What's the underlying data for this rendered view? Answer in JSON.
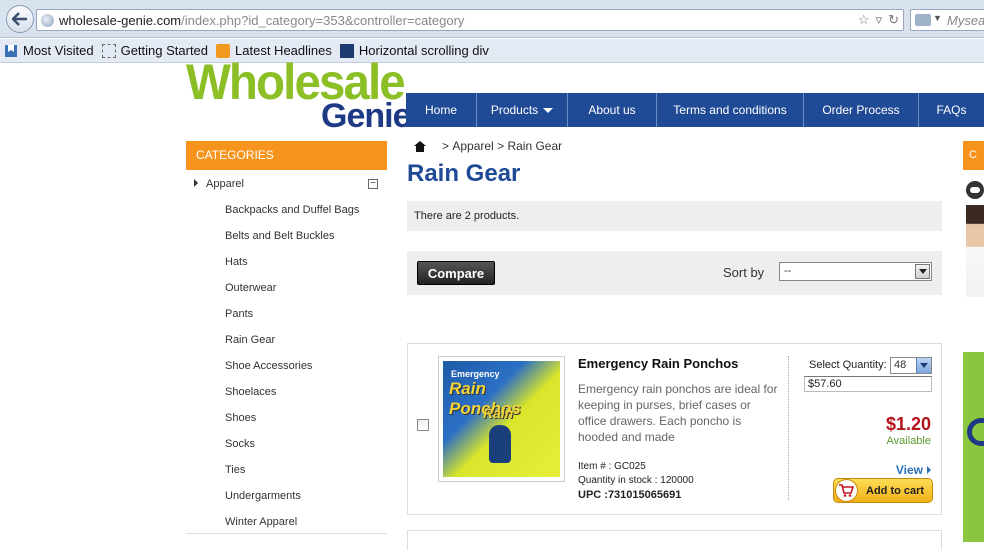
{
  "browser": {
    "url_domain": "wholesale-genie.com",
    "url_path": "/index.php?id_category=353&controller=category",
    "search_placeholder": "Mysear",
    "bookmarks": [
      "Most Visited",
      "Getting Started",
      "Latest Headlines",
      "Horizontal scrolling div"
    ]
  },
  "logo": {
    "line1": "Wholesale",
    "line2": "Genie"
  },
  "nav": [
    "Home",
    "Products",
    "About us",
    "Terms and conditions",
    "Order Process",
    "FAQs"
  ],
  "sidebar": {
    "heading": "CATEGORIES",
    "parent": "Apparel",
    "collapse_symbol": "−",
    "items": [
      "Backpacks and Duffel Bags",
      "Belts and Belt Buckles",
      "Hats",
      "Outerwear",
      "Pants",
      "Rain Gear",
      "Shoe Accessories",
      "Shoelaces",
      "Shoes",
      "Socks",
      "Ties",
      "Undergarments",
      "Winter Apparel"
    ]
  },
  "breadcrumb": {
    "sep": ">",
    "parent": "Apparel",
    "current": "Rain Gear"
  },
  "page_title": "Rain Gear",
  "product_count": "There are 2 products.",
  "toolbar": {
    "compare": "Compare",
    "sort_label": "Sort by",
    "sort_value": "--"
  },
  "product": {
    "image_brand": "Emergency",
    "image_title": "Rain Ponchos",
    "image_subtitle": "Rain",
    "name": "Emergency Rain Ponchos",
    "description": "Emergency rain ponchos are ideal for keeping in purses, brief cases or office drawers. Each poncho is hooded and made",
    "item_no": "Item # : GC025",
    "stock": "Quantity in stock : 120000",
    "upc": "UPC :731015065691",
    "qty_label": "Select Quantity:",
    "qty_value": "48",
    "qty_total": "$57.60",
    "price": "$1.20",
    "availability": "Available",
    "view": "View",
    "add_to_cart": "Add to cart"
  },
  "right_column": {
    "heading_fragment": "C"
  }
}
